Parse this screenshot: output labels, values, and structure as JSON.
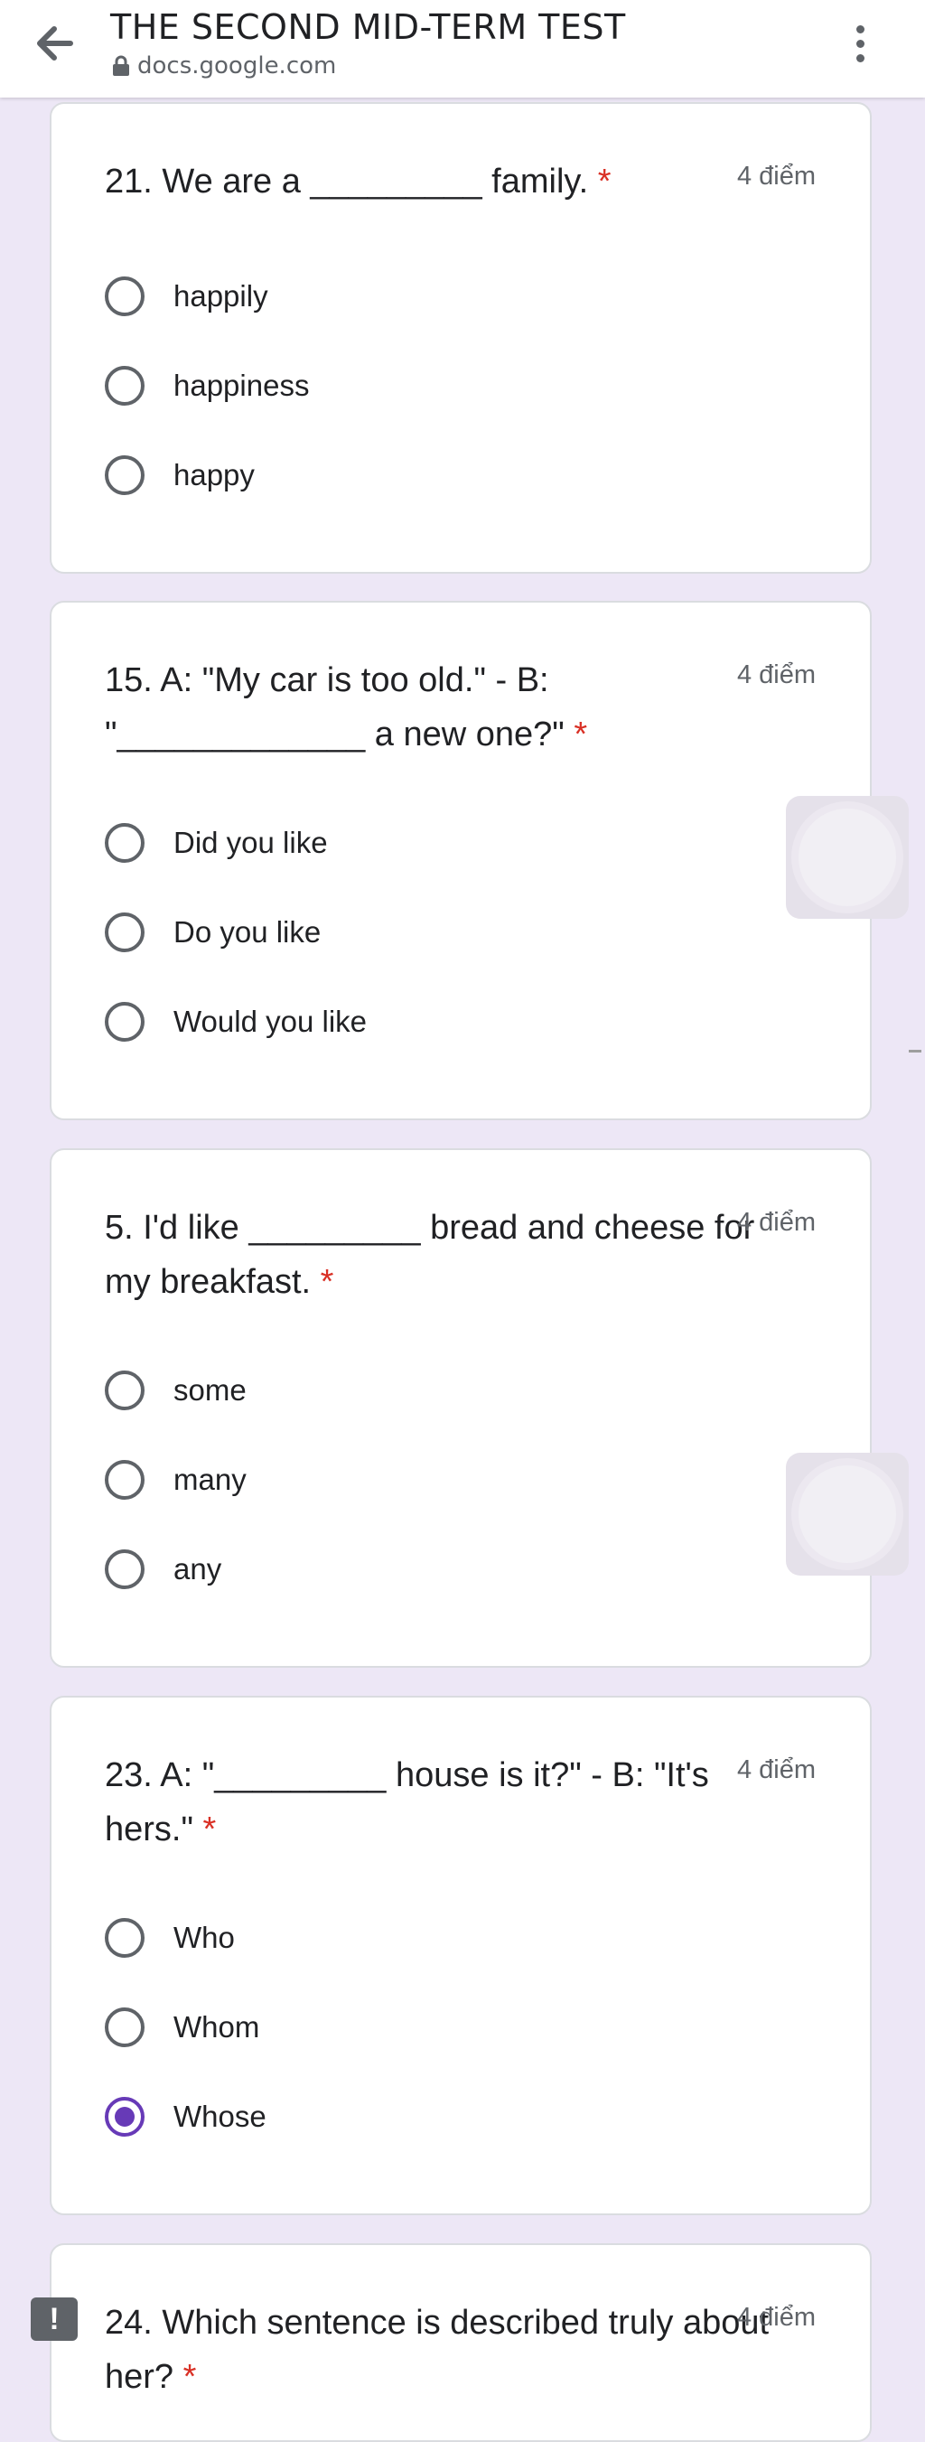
{
  "header": {
    "title": "THE SECOND MID-TERM TEST",
    "url": "docs.google.com"
  },
  "questions": [
    {
      "text": "21. We are a _________ family.",
      "required": "*",
      "points": "4 điểm",
      "options": [
        "happily",
        "happiness",
        "happy"
      ],
      "selected": null
    },
    {
      "text": "15. A: \"My car is too old.\" - B: \"_____________ a new one?\"",
      "required": "*",
      "points": "4 điểm",
      "options": [
        "Did you like",
        "Do you like",
        "Would you like"
      ],
      "selected": null
    },
    {
      "text": "5. I'd like _________ bread and cheese for my breakfast.",
      "required": "*",
      "points": "4 điểm",
      "options": [
        "some",
        "many",
        "any"
      ],
      "selected": null
    },
    {
      "text": "23. A: \"_________ house is it?\" - B: \"It's hers.\"",
      "required": "*",
      "points": "4 điểm",
      "options": [
        "Who",
        "Whom",
        "Whose"
      ],
      "selected": "Whose"
    },
    {
      "text": "24. Which sentence is described truly about her?",
      "required": "*",
      "points": "4 điểm",
      "options": [],
      "selected": null
    }
  ],
  "report_icon": "!",
  "colors": {
    "accent": "#673ab7",
    "required": "#d93025",
    "background": "#ede7f6"
  }
}
